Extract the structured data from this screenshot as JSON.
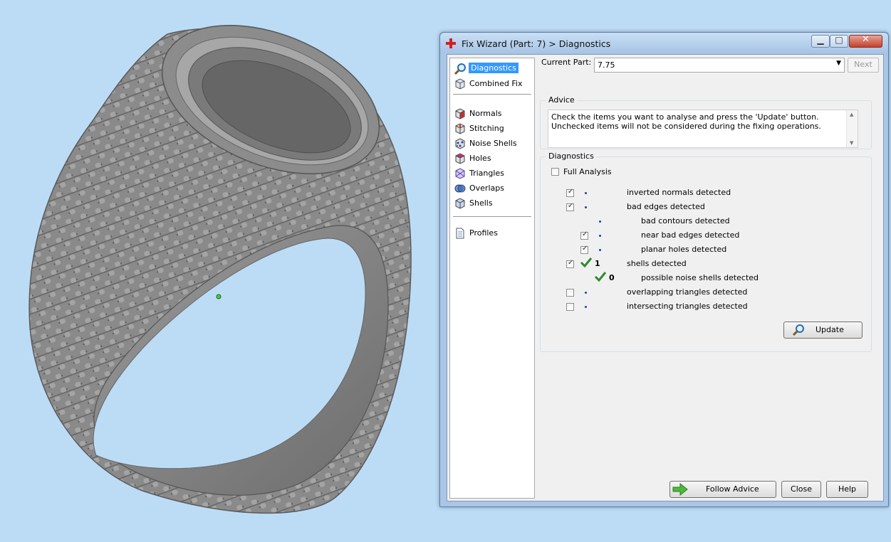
{
  "window": {
    "title": "Fix Wizard (Part: 7) > Diagnostics"
  },
  "nav": {
    "top_items": [
      {
        "label": "Diagnostics",
        "icon": "magnifier-icon",
        "selected": true
      },
      {
        "label": "Combined Fix",
        "icon": "cube-icon"
      }
    ],
    "fix_items": [
      {
        "label": "Normals",
        "icon": "normals-cube-icon"
      },
      {
        "label": "Stitching",
        "icon": "stitching-cube-icon"
      },
      {
        "label": "Noise Shells",
        "icon": "noise-shells-icon"
      },
      {
        "label": "Holes",
        "icon": "holes-cube-icon"
      },
      {
        "label": "Triangles",
        "icon": "triangles-icon"
      },
      {
        "label": "Overlaps",
        "icon": "overlaps-icon"
      },
      {
        "label": "Shells",
        "icon": "shells-icon"
      }
    ],
    "bottom_items": [
      {
        "label": "Profiles",
        "icon": "document-icon"
      }
    ]
  },
  "current_part": {
    "label": "Current Part:",
    "value": "7.75",
    "next_label": "Next"
  },
  "advice": {
    "title": "Advice",
    "text": "Check the items you want to analyse and press the 'Update' button. Unchecked items will not be considered during the fixing operations."
  },
  "diagnostics": {
    "title": "Diagnostics",
    "full_analysis_label": "Full Analysis",
    "full_analysis_checked": false,
    "rows": [
      {
        "label": "inverted normals detected",
        "checked": true,
        "result": "dot"
      },
      {
        "label": "bad edges detected",
        "checked": true,
        "result": "dot"
      },
      {
        "label": "bad contours detected",
        "result": "dot"
      },
      {
        "label": "near bad edges detected",
        "checked": true,
        "result": "dot"
      },
      {
        "label": "planar holes detected",
        "checked": true,
        "result": "dot"
      },
      {
        "label": "shells detected",
        "checked": true,
        "result": "check",
        "count": "1"
      },
      {
        "label": "possible noise shells detected",
        "result": "check",
        "count": "0"
      },
      {
        "label": "overlapping triangles detected",
        "checked": false,
        "result": "dot"
      },
      {
        "label": "intersecting triangles detected",
        "checked": false,
        "result": "dot"
      }
    ],
    "update_label": "Update"
  },
  "footer": {
    "follow_advice_label": "Follow Advice",
    "close_label": "Close",
    "help_label": "Help"
  },
  "colors": {
    "viewport_background": "#bcdcf6",
    "model_gray": "#7a7a7a",
    "selection_blue": "#3399ff",
    "check_green": "#2e8b2e"
  }
}
